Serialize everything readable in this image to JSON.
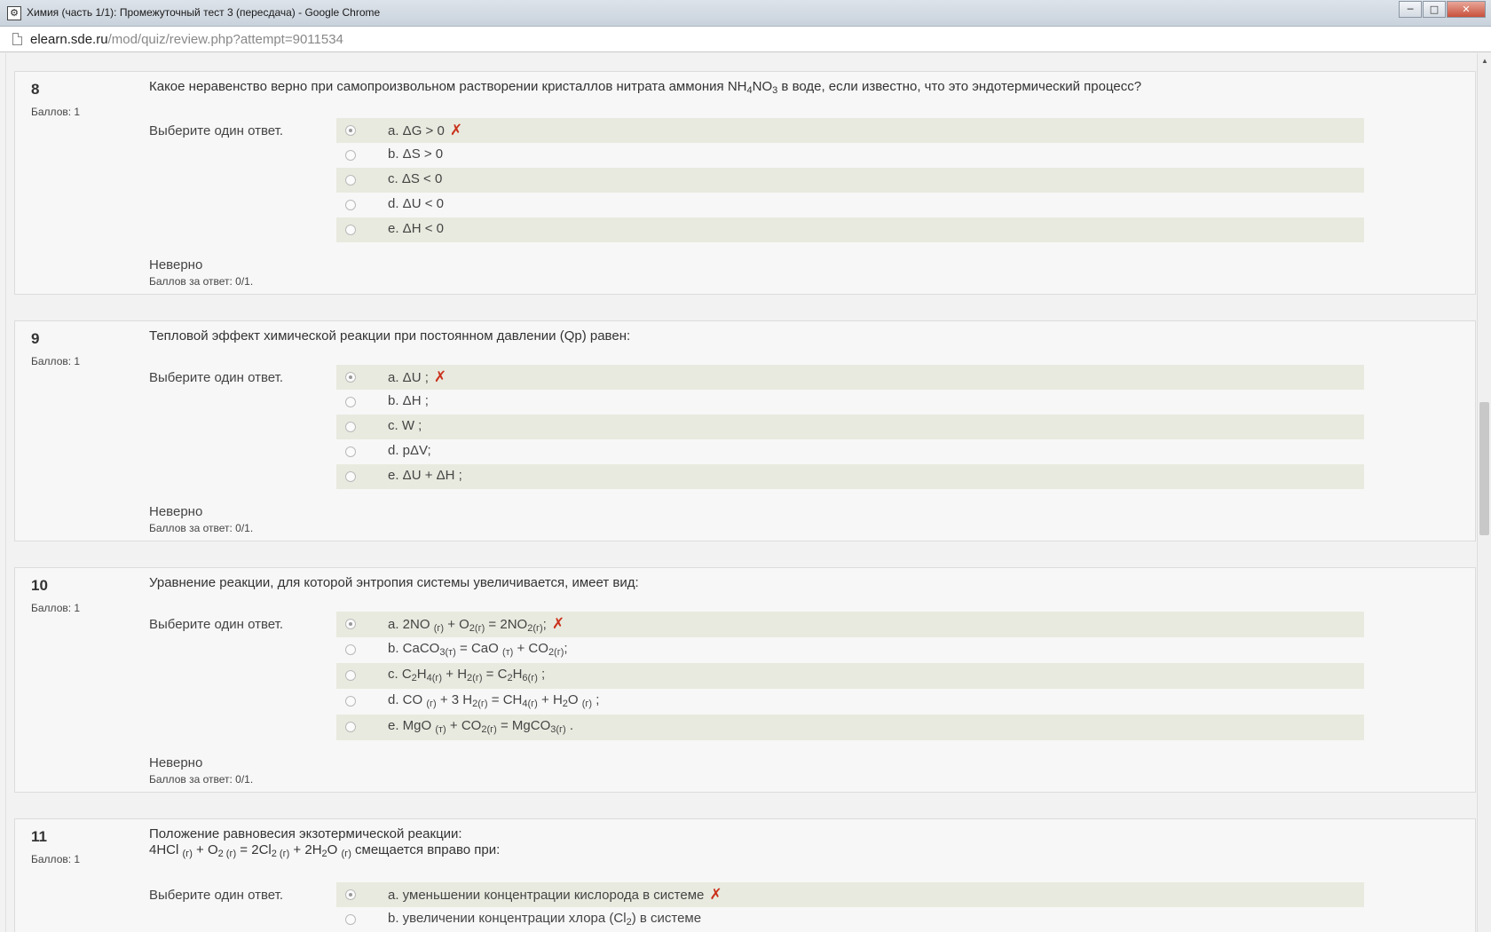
{
  "window": {
    "title": "Химия (часть 1/1): Промежуточный тест 3 (пересдача) - Google Chrome",
    "controls": {
      "minimize": "─",
      "maximize": "□",
      "close": "✕"
    }
  },
  "address": {
    "host": "elearn.sde.ru",
    "path": "/mod/quiz/review.php?attempt=9011534"
  },
  "questions": [
    {
      "number": "8",
      "grade": "Баллов: 1",
      "prompt": "Выберите один ответ.",
      "feedback": "Неверно",
      "score": "Баллов за ответ: 0/1.",
      "text_a": "Какое неравенство верно при самопроизвольном растворении кристаллов нитрата аммония NH",
      "text_b": "4",
      "text_c": "NO",
      "text_d": "3",
      "text_e": " в воде, если известно, что это эндотермический процесс?",
      "answers": [
        {
          "label": "a. ΔG > 0",
          "selected": true
        },
        {
          "label": "b. ΔS > 0",
          "selected": false
        },
        {
          "label": "c. ΔS < 0",
          "selected": false
        },
        {
          "label": "d. ΔU < 0",
          "selected": false
        },
        {
          "label": "e. ΔH < 0",
          "selected": false
        }
      ]
    },
    {
      "number": "9",
      "grade": "Баллов: 1",
      "prompt": "Выберите один ответ.",
      "feedback": "Неверно",
      "score": "Баллов за ответ: 0/1.",
      "text": "Тепловой эффект химической реакции при постоянном давлении (Qp) равен:",
      "answers": [
        {
          "label": "a. ΔU ;",
          "selected": true
        },
        {
          "label": "b. ΔH ;",
          "selected": false
        },
        {
          "label": "c. W ;",
          "selected": false
        },
        {
          "label": "d. pΔV;",
          "selected": false
        },
        {
          "label": "e. ΔU + ΔH ;",
          "selected": false
        }
      ]
    },
    {
      "number": "10",
      "grade": "Баллов: 1",
      "prompt": "Выберите один ответ.",
      "feedback": "Неверно",
      "score": "Баллов за ответ: 0/1.",
      "text": "Уравнение реакции, для которой энтропия системы увеличивается, имеет вид:",
      "answers": [
        {
          "parts": [
            "a. 2NO ",
            "(г)",
            " + O",
            "2(г)",
            " = 2NO",
            "2(г)",
            ";"
          ],
          "selected": true
        },
        {
          "parts": [
            "b. CaCO",
            "3(т)",
            " = CaO ",
            "(т)",
            " + CO",
            "2(г)",
            ";"
          ],
          "selected": false
        },
        {
          "parts": [
            "c. C",
            "2",
            "H",
            "4(г)",
            " + H",
            "2(г)",
            " = C",
            "2",
            "H",
            "6(г)",
            " ;"
          ],
          "selected": false
        },
        {
          "parts": [
            "d. CO ",
            "(г)",
            " + 3 H",
            "2(г)",
            " = CH",
            "4(г)",
            " + H",
            "2",
            "O ",
            "(г)",
            " ;"
          ],
          "selected": false
        },
        {
          "parts": [
            "e. MgO ",
            "(т)",
            " + CO",
            "2(г)",
            " = MgCO",
            "3(г)",
            " ."
          ],
          "selected": false
        }
      ]
    },
    {
      "number": "11",
      "grade": "Баллов: 1",
      "prompt": "Выберите один ответ.",
      "text_line1": "Положение равновесия экзотермической реакции:",
      "text_line2_parts": [
        "4HCl ",
        "(г)",
        " + O",
        "2 (г)",
        " = 2Cl",
        "2 (г)",
        " + 2H",
        "2",
        "O ",
        "(г)",
        " смещается вправо при:"
      ],
      "answers": [
        {
          "parts": [
            "a. уменьшении концентрации кислорода в системе"
          ],
          "selected": true
        },
        {
          "parts": [
            "b. увеличении концентрации хлора (Cl",
            "2",
            ") в системе"
          ],
          "selected": false
        }
      ]
    }
  ],
  "wrong_mark": "✗"
}
